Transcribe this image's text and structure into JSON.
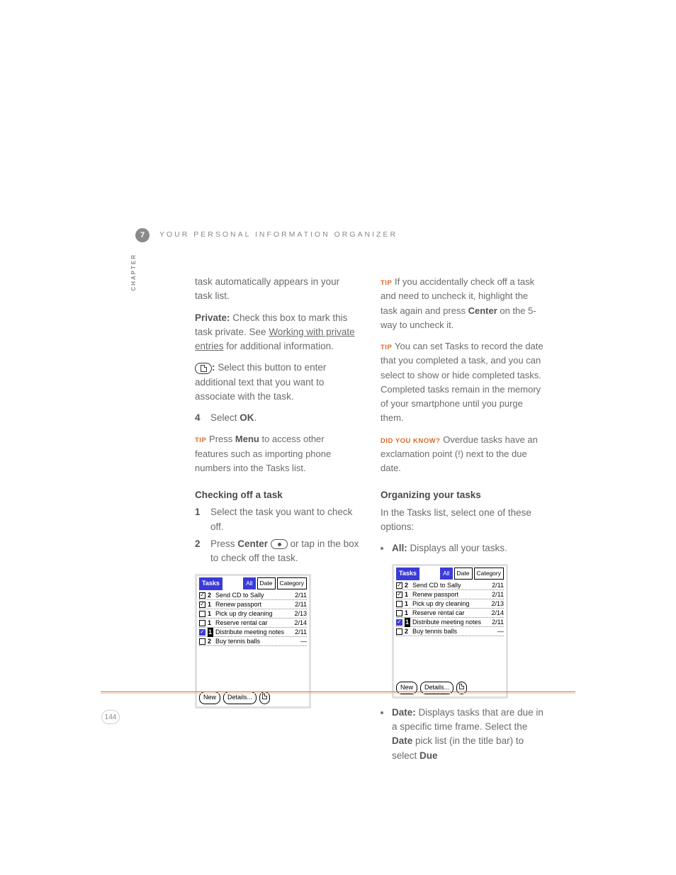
{
  "chapter_number": "7",
  "chapter_label": "CHAPTER",
  "header_subtitle": "YOUR PERSONAL INFORMATION ORGANIZER",
  "page_number": "144",
  "col1": {
    "intro_cont": "task automatically appears in your task list.",
    "private_label": "Private:",
    "private_text": " Check this box to mark this task private. See ",
    "private_link": "Working with private entries",
    "private_text2": " for additional information.",
    "note_colon": ":",
    "note_text": " Select this button to enter additional text that you want to associate with the task.",
    "step4_num": "4",
    "step4_text_a": "Select ",
    "step4_bold": "OK",
    "step4_text_b": ".",
    "tip_press_a": "Press ",
    "tip_press_bold": "Menu",
    "tip_press_b": " to access other features such as importing phone numbers into the Tasks list.",
    "checking_heading": "Checking off a task",
    "step1_num": "1",
    "step1_text": "Select the task you want to check off.",
    "step2_num": "2",
    "step2_a": "Press ",
    "step2_bold": "Center",
    "step2_b": " or tap in the box to check off the task."
  },
  "col2": {
    "tip1_a": "If you accidentally check off a task and need to uncheck it, highlight the task again and press ",
    "tip1_bold": "Center",
    "tip1_b": " on the 5-way to uncheck it.",
    "tip2": "You can set Tasks to record the date that you completed a task, and you can select to show or hide completed tasks. Completed tasks remain in the memory of your smartphone until you purge them.",
    "dyk": "Overdue tasks have an exclamation point (!) next to the due date.",
    "org_heading": "Organizing your tasks",
    "org_intro": "In the Tasks list, select one of these options:",
    "bullet_all_bold": "All:",
    "bullet_all_text": " Displays all your tasks.",
    "bullet_date_bold": "Date:",
    "bullet_date_a": " Displays tasks that are due in a specific time frame. Select the ",
    "bullet_date_bold2": "Date",
    "bullet_date_b": " pick list (in the title bar) to select ",
    "bullet_date_bold3": "Due"
  },
  "labels": {
    "tip": "TIP",
    "dyk": "DID YOU KNOW?"
  },
  "tasks_screen": {
    "title": "Tasks",
    "pick_all": "All",
    "pick_date": "Date",
    "pick_cat": "Category",
    "btn_new": "New",
    "btn_details": "Details...",
    "rows": [
      {
        "chk": true,
        "chkblue": false,
        "pri": "2",
        "prihl": false,
        "name": "Send CD to Sally",
        "date": "2/11"
      },
      {
        "chk": true,
        "chkblue": false,
        "pri": "1",
        "prihl": false,
        "name": "Renew passport",
        "date": "2/11"
      },
      {
        "chk": false,
        "chkblue": false,
        "pri": "1",
        "prihl": false,
        "name": "Pick up dry cleaning",
        "date": "2/13"
      },
      {
        "chk": false,
        "chkblue": false,
        "pri": "1",
        "prihl": false,
        "name": "Reserve rental car",
        "date": "2/14"
      },
      {
        "chk": true,
        "chkblue": true,
        "pri": "1",
        "prihl": true,
        "name": "Distribute meeting notes",
        "date": "2/11"
      },
      {
        "chk": false,
        "chkblue": false,
        "pri": "2",
        "prihl": false,
        "name": "Buy tennis balls",
        "date": "—"
      }
    ]
  }
}
